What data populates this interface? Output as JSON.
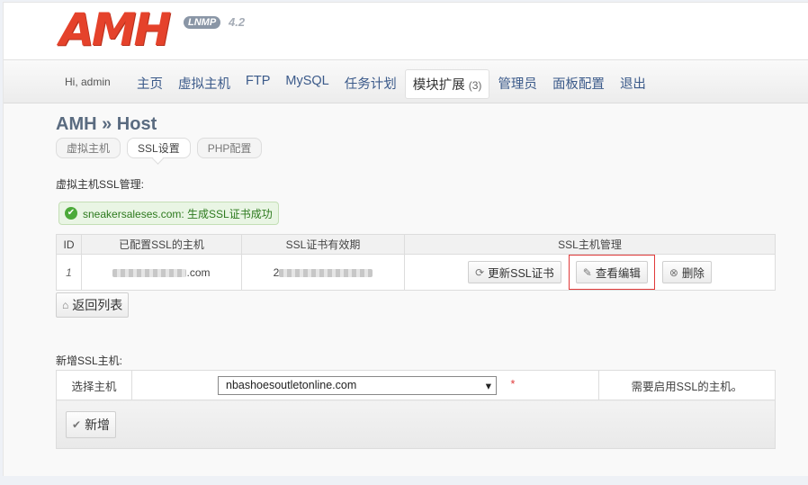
{
  "logo": {
    "main": "AMH",
    "badge": "LNMP",
    "version": "4.2"
  },
  "nav": {
    "greeting": "Hi, admin",
    "items": [
      {
        "label": "主页"
      },
      {
        "label": "虚拟主机"
      },
      {
        "label": "FTP"
      },
      {
        "label": "MySQL"
      },
      {
        "label": "任务计划"
      },
      {
        "label": "模块扩展",
        "count": "(3)",
        "active": true
      },
      {
        "label": "管理员"
      },
      {
        "label": "面板配置"
      },
      {
        "label": "退出"
      }
    ]
  },
  "page": {
    "title": "AMH » Host",
    "subtabs": [
      "虚拟主机",
      "SSL设置",
      "PHP配置"
    ],
    "active_subtab": "SSL设置"
  },
  "ssl_section": {
    "label": "虚拟主机SSL管理:",
    "success_icon": "check-circle-icon",
    "success_message": "sneakersaleses.com: 生成SSL证书成功",
    "headers": [
      "ID",
      "已配置SSL的主机",
      "SSL证书有效期",
      "SSL主机管理"
    ],
    "rows": [
      {
        "id": "1",
        "host_suffix": ".com",
        "expiry_prefix": "2"
      }
    ],
    "actions": {
      "renew": "更新SSL证书",
      "view_edit": "查看编辑",
      "delete": "删除"
    },
    "back_button": "返回列表"
  },
  "add_section": {
    "label": "新增SSL主机:",
    "select_label": "选择主机",
    "selected_host": "nbashoesoutletonline.com",
    "required_mark": "*",
    "hint": "需要启用SSL的主机。",
    "add_button": "新增"
  },
  "colors": {
    "brand": "#e5422b",
    "nav_link": "#3b5a8a",
    "success": "#4caa3a",
    "highlight_border": "#e03a3a"
  }
}
